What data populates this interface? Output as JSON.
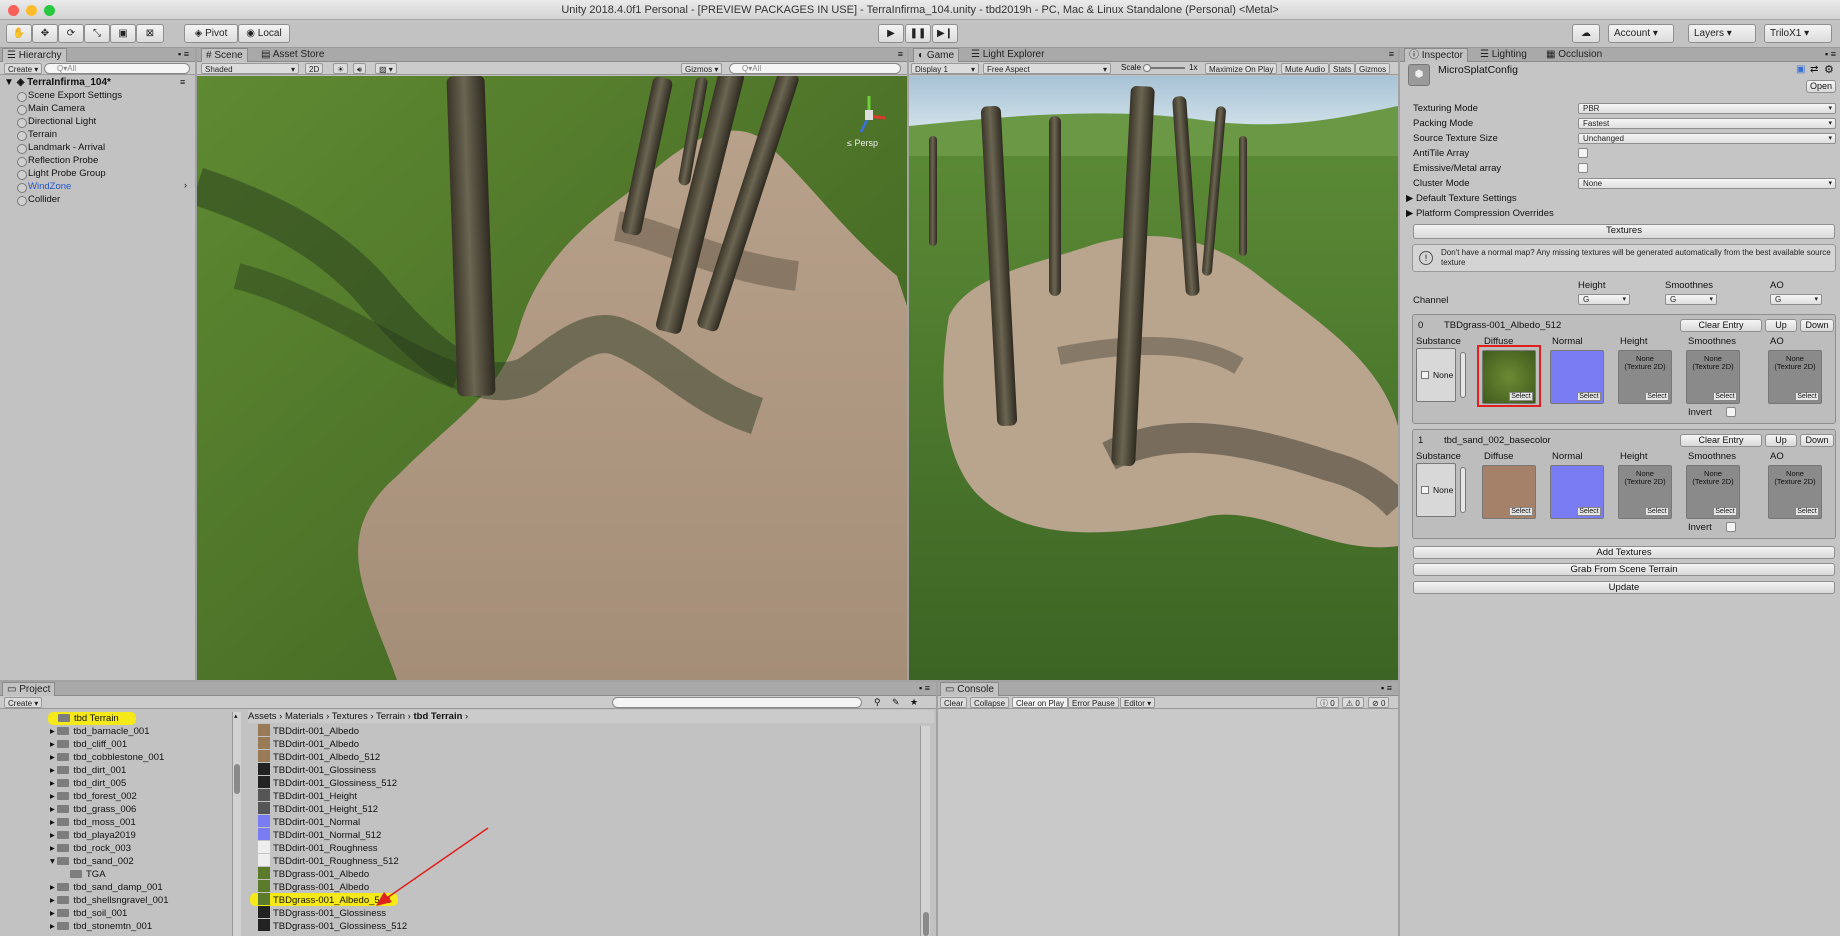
{
  "window": {
    "title": "Unity 2018.4.0f1 Personal - [PREVIEW PACKAGES IN USE] - TerraInfirma_104.unity - tbd2019h - PC, Mac & Linux Standalone (Personal) <Metal>"
  },
  "toolbar": {
    "pivot": "Pivot",
    "local": "Local",
    "account": "Account",
    "layers": "Layers",
    "layout": "TriloX1"
  },
  "hierarchy": {
    "tab": "Hierarchy",
    "create": "Create",
    "search_placeholder": "Q▾All",
    "scene": "TerraInfirma_104*",
    "items": [
      "Scene Export Settings",
      "Main Camera",
      "Directional Light",
      "Terrain",
      "Landmark - Arrival",
      "Reflection Probe",
      "Light Probe Group",
      "WindZone",
      "Collider"
    ]
  },
  "scene": {
    "tab": "Scene",
    "tab2": "Asset Store",
    "shading": "Shaded",
    "mode2d": "2D",
    "gizmos": "Gizmos",
    "search": "Q▾All",
    "persp": "≤ Persp"
  },
  "game": {
    "tab": "Game",
    "tab2": "Light Explorer",
    "display": "Display 1",
    "aspect": "Free Aspect",
    "scale_label": "Scale",
    "scale_value": "1x",
    "maximize": "Maximize On Play",
    "mute": "Mute Audio",
    "stats": "Stats",
    "gizmos": "Gizmos"
  },
  "inspector": {
    "tabs": [
      "Inspector",
      "Lighting",
      "Occlusion"
    ],
    "object_name": "MicroSplatConfig",
    "open": "Open",
    "fields": [
      {
        "label": "Texturing Mode",
        "value": "PBR"
      },
      {
        "label": "Packing Mode",
        "value": "Fastest"
      },
      {
        "label": "Source Texture Size",
        "value": "Unchanged"
      }
    ],
    "antitile": "AntiTile Array",
    "emissive": "Emissive/Metal array",
    "cluster_label": "Cluster Mode",
    "cluster_value": "None",
    "default_tex": "Default Texture Settings",
    "platform": "Platform Compression Overrides",
    "textures_header": "Textures",
    "info": "Don't have a normal map? Any missing textures will be generated automatically from the best available source texture",
    "channel": "Channel",
    "channel_cols": [
      {
        "label": "Height",
        "value": "G"
      },
      {
        "label": "Smoothnes",
        "value": "G"
      },
      {
        "label": "AO",
        "value": "G"
      }
    ],
    "entries": [
      {
        "index": "0",
        "name": "TBDgrass-001_Albedo_512"
      },
      {
        "index": "1",
        "name": "tbd_sand_002_basecolor"
      }
    ],
    "entry_btns": {
      "clear": "Clear Entry",
      "up": "Up",
      "down": "Down"
    },
    "slot_labels": [
      "Substance",
      "Diffuse",
      "Normal",
      "Height",
      "Smoothnes",
      "AO"
    ],
    "none": "None",
    "none_tex": "None\n(Texture 2D)",
    "select": "Select",
    "invert": "Invert",
    "add_textures": "Add Textures",
    "grab": "Grab From Scene Terrain",
    "update": "Update"
  },
  "project": {
    "tab": "Project",
    "create": "Create",
    "breadcrumb": [
      "Assets",
      "Materials",
      "Textures",
      "Terrain",
      "tbd Terrain"
    ],
    "folders": [
      "tbd Terrain",
      "tbd_barnacle_001",
      "tbd_cliff_001",
      "tbd_cobblestone_001",
      "tbd_dirt_001",
      "tbd_dirt_005",
      "tbd_forest_002",
      "tbd_grass_006",
      "tbd_moss_001",
      "tbd_playa2019",
      "tbd_rock_003",
      "tbd_sand_002",
      "TGA",
      "tbd_sand_damp_001",
      "tbd_shellsngravel_001",
      "tbd_soil_001",
      "tbd_stonemtn_001"
    ],
    "assets": [
      "TBDdirt-001_Albedo",
      "TBDdirt-001_Albedo",
      "TBDdirt-001_Albedo_512",
      "TBDdirt-001_Glossiness",
      "TBDdirt-001_Glossiness_512",
      "TBDdirt-001_Height",
      "TBDdirt-001_Height_512",
      "TBDdirt-001_Normal",
      "TBDdirt-001_Normal_512",
      "TBDdirt-001_Roughness",
      "TBDdirt-001_Roughness_512",
      "TBDgrass-001_Albedo",
      "TBDgrass-001_Albedo",
      "TBDgrass-001_Albedo_512",
      "TBDgrass-001_Glossiness",
      "TBDgrass-001_Glossiness_512"
    ]
  },
  "console": {
    "tab": "Console",
    "buttons": [
      "Clear",
      "Collapse",
      "Clear on Play",
      "Error Pause",
      "Editor"
    ],
    "counts": [
      "0",
      "0",
      "0"
    ]
  },
  "colors": {
    "highlight": "#f5e91a",
    "selection_red": "#e0201c",
    "accent_blue": "#3b6fd4"
  }
}
